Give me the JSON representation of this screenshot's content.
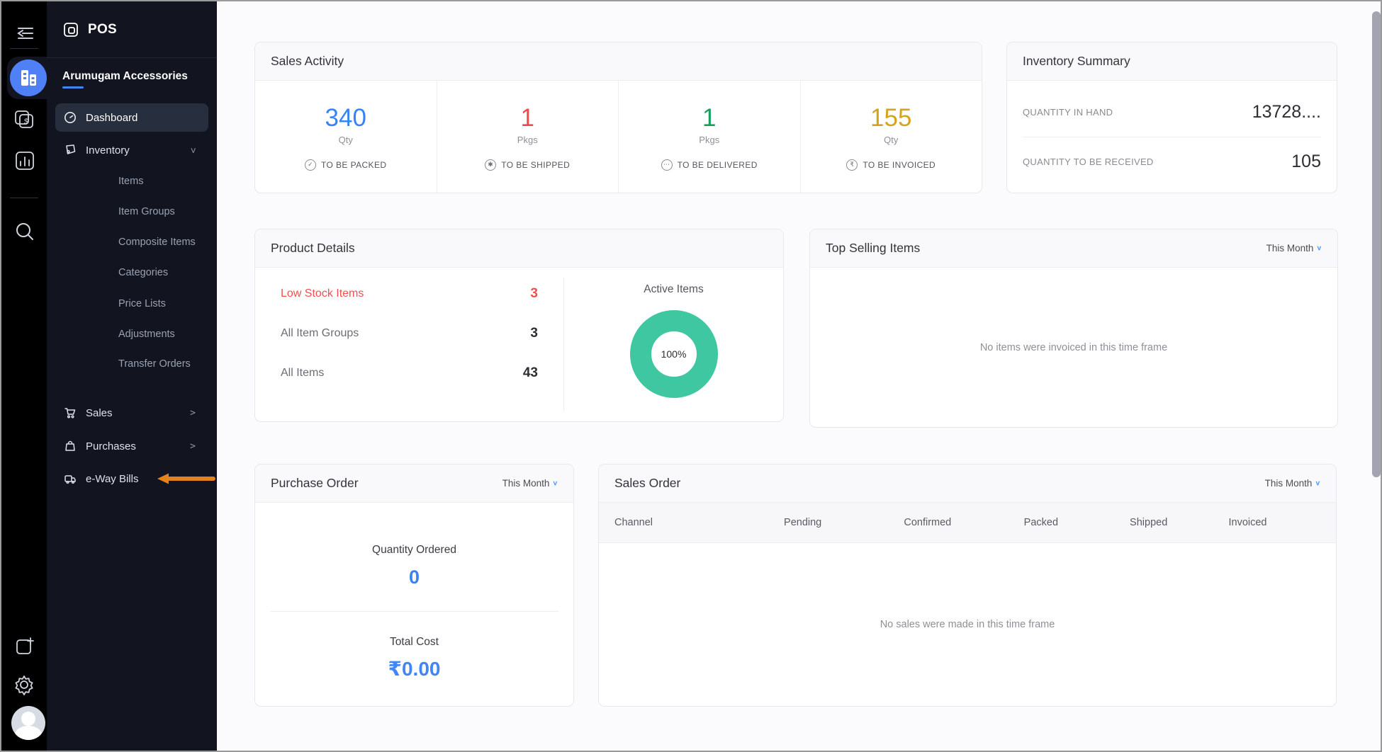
{
  "app": {
    "name": "POS"
  },
  "org": {
    "name": "Arumugam Accessories"
  },
  "rail": {
    "icons": [
      "collapse-sidebar-icon",
      "pos-app-icon",
      "payments-cards-icon",
      "reports-barchart-icon",
      "search-icon",
      "add-document-icon",
      "settings-gear-icon",
      "user-avatar"
    ]
  },
  "sidebar": {
    "dashboard": "Dashboard",
    "inventory": "Inventory",
    "inventory_children": [
      "Items",
      "Item Groups",
      "Composite Items",
      "Categories",
      "Price Lists",
      "Adjustments",
      "Transfer Orders"
    ],
    "sales": "Sales",
    "purchases": "Purchases",
    "eway": "e-Way Bills",
    "annotation_arrow_color": "#e5821f"
  },
  "sales_activity": {
    "title": "Sales Activity",
    "stats": [
      {
        "value": "340",
        "unit": "Qty",
        "label": "TO BE PACKED",
        "color": "#3584f7",
        "icon": "check-circle-icon",
        "icon_glyph": "✓"
      },
      {
        "value": "1",
        "unit": "Pkgs",
        "label": "TO BE SHIPPED",
        "color": "#ec4a4d",
        "icon": "shipped-circle-icon",
        "icon_glyph": "✱"
      },
      {
        "value": "1",
        "unit": "Pkgs",
        "label": "TO BE DELIVERED",
        "color": "#16a05c",
        "icon": "delivered-circle-icon",
        "icon_glyph": "⋯"
      },
      {
        "value": "155",
        "unit": "Qty",
        "label": "TO BE INVOICED",
        "color": "#d6a41c",
        "icon": "invoiced-circle-icon",
        "icon_glyph": "₹"
      }
    ]
  },
  "inventory_summary": {
    "title": "Inventory Summary",
    "rows": [
      {
        "label": "QUANTITY IN HAND",
        "value": "13728...."
      },
      {
        "label": "QUANTITY TO BE RECEIVED",
        "value": "105"
      }
    ]
  },
  "product_details": {
    "title": "Product Details",
    "rows": [
      {
        "label": "Low Stock Items",
        "value": "3"
      },
      {
        "label": "All Item Groups",
        "value": "3"
      },
      {
        "label": "All Items",
        "value": "43"
      }
    ],
    "active_items": {
      "label": "Active Items",
      "percent": "100%",
      "ring_color": "#3fc7a2"
    }
  },
  "top_selling": {
    "title": "Top Selling Items",
    "filter": "This Month",
    "empty": "No items were invoiced in this time frame"
  },
  "purchase_order": {
    "title": "Purchase Order",
    "filter": "This Month",
    "quantity_label": "Quantity Ordered",
    "quantity_value": "0",
    "cost_label": "Total Cost",
    "cost_value": "₹0.00"
  },
  "sales_order": {
    "title": "Sales Order",
    "filter": "This Month",
    "columns": [
      "Channel",
      "Pending",
      "Confirmed",
      "Packed",
      "Shipped",
      "Invoiced"
    ],
    "empty": "No sales were made in this time frame"
  }
}
